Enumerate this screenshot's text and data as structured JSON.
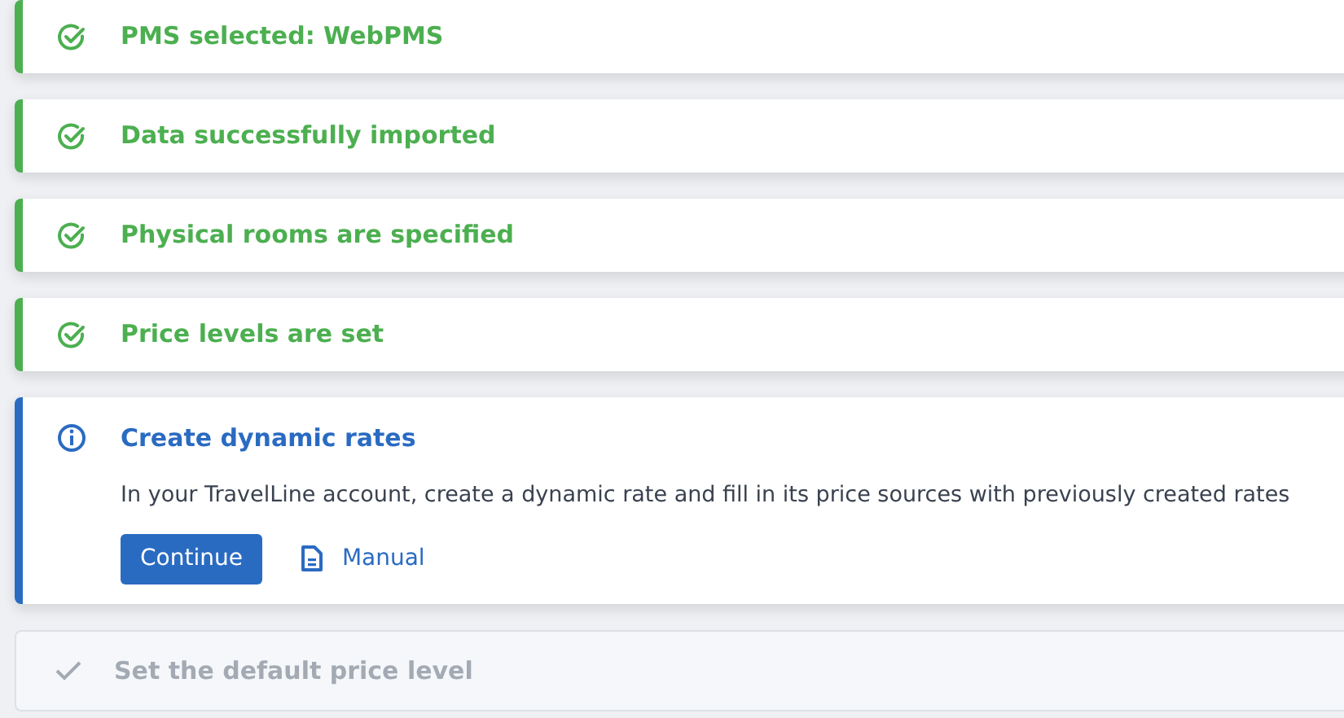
{
  "steps": [
    {
      "kind": "done",
      "title": "PMS selected: WebPMS"
    },
    {
      "kind": "done",
      "title": "Data successfully imported"
    },
    {
      "kind": "done",
      "title": "Physical rooms are specified"
    },
    {
      "kind": "done",
      "title": "Price levels are set"
    },
    {
      "kind": "active",
      "title": "Create dynamic rates",
      "description": "In your TravelLine account, create a dynamic rate and fill in its price sources with previously created rates",
      "button": "Continue",
      "link": "Manual"
    },
    {
      "kind": "pending",
      "title": "Set the default price level"
    }
  ]
}
